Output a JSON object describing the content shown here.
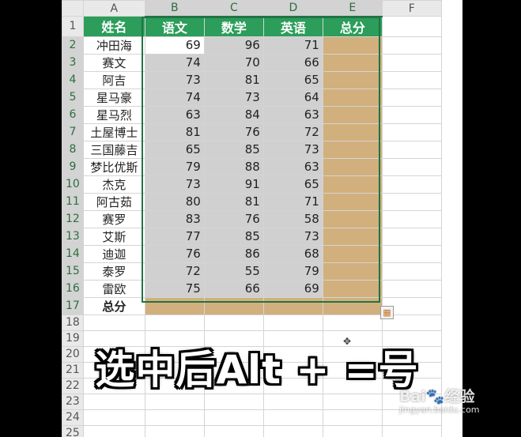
{
  "columns": [
    "A",
    "B",
    "C",
    "D",
    "E",
    "F"
  ],
  "headers": [
    "姓名",
    "语文",
    "数学",
    "英语",
    "总分"
  ],
  "rows": [
    {
      "n": "2",
      "name": "冲田海",
      "c": "69",
      "m": "96",
      "e": "71"
    },
    {
      "n": "3",
      "name": "赛文",
      "c": "74",
      "m": "70",
      "e": "66"
    },
    {
      "n": "4",
      "name": "阿吉",
      "c": "73",
      "m": "81",
      "e": "65"
    },
    {
      "n": "5",
      "name": "星马豪",
      "c": "74",
      "m": "73",
      "e": "64"
    },
    {
      "n": "6",
      "name": "星马烈",
      "c": "63",
      "m": "84",
      "e": "63"
    },
    {
      "n": "7",
      "name": "土屋博士",
      "c": "81",
      "m": "76",
      "e": "72"
    },
    {
      "n": "8",
      "name": "三国藤吉",
      "c": "65",
      "m": "85",
      "e": "73"
    },
    {
      "n": "9",
      "name": "梦比优斯",
      "c": "79",
      "m": "88",
      "e": "63"
    },
    {
      "n": "10",
      "name": "杰克",
      "c": "73",
      "m": "91",
      "e": "65"
    },
    {
      "n": "11",
      "name": "阿古茹",
      "c": "80",
      "m": "81",
      "e": "71"
    },
    {
      "n": "12",
      "name": "赛罗",
      "c": "83",
      "m": "76",
      "e": "58"
    },
    {
      "n": "13",
      "name": "艾斯",
      "c": "77",
      "m": "85",
      "e": "73"
    },
    {
      "n": "14",
      "name": "迪迦",
      "c": "76",
      "m": "86",
      "e": "68"
    },
    {
      "n": "15",
      "name": "泰罗",
      "c": "72",
      "m": "55",
      "e": "79"
    },
    {
      "n": "16",
      "name": "雷欧",
      "c": "75",
      "m": "66",
      "e": "69"
    }
  ],
  "row1": "1",
  "total_row": {
    "n": "17",
    "label": "总分"
  },
  "empty_rows": [
    "18",
    "19",
    "20",
    "21",
    "22",
    "23",
    "24",
    "25"
  ],
  "caption": "选中后Alt + =号",
  "watermark": {
    "brand": "Bai",
    "brand2": "经验",
    "sub": "jingyan.baidu.com"
  },
  "colors": {
    "header_green": "#2c9d5a",
    "total_tan": "#d1b07d",
    "range_gray": "#d0d0d0",
    "selection": "#217346"
  },
  "icons": {
    "quick_analysis": "quick-analysis-icon",
    "cursor": "move-cursor-icon"
  }
}
